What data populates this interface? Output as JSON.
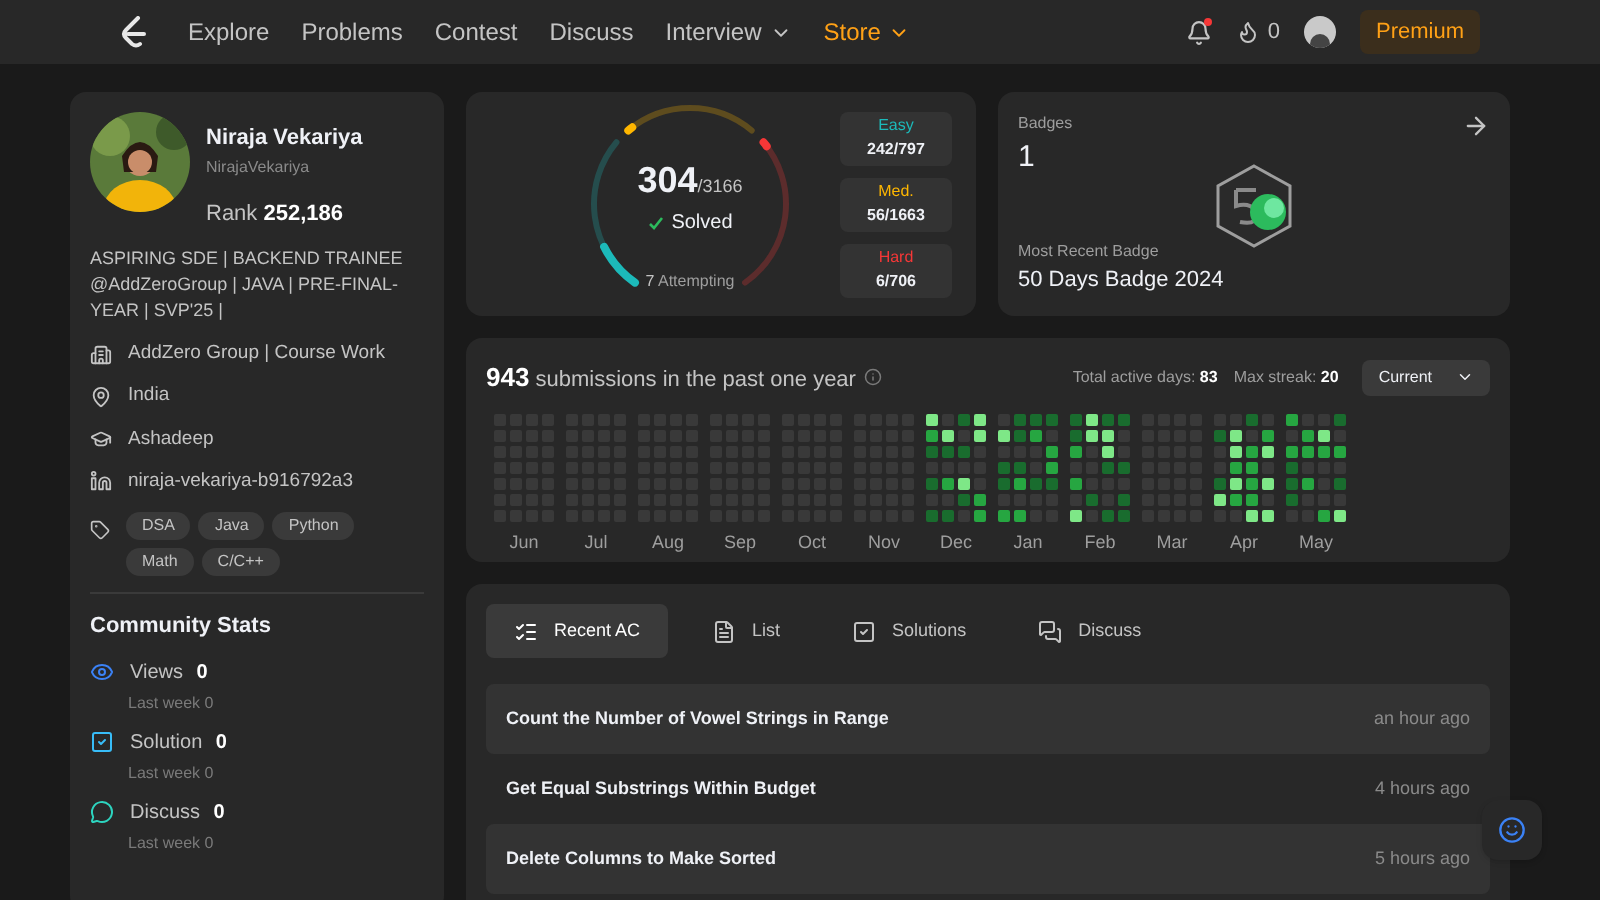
{
  "nav": {
    "links": [
      {
        "label": "Explore",
        "kind": "link"
      },
      {
        "label": "Problems",
        "kind": "link"
      },
      {
        "label": "Contest",
        "kind": "link"
      },
      {
        "label": "Discuss",
        "kind": "link"
      },
      {
        "label": "Interview",
        "kind": "menu"
      },
      {
        "label": "Store",
        "kind": "store"
      }
    ],
    "streak": "0",
    "premium": "Premium"
  },
  "profile": {
    "name": "Niraja Vekariya",
    "username": "NirajaVekariya",
    "rank_label": "Rank",
    "rank": "252,186",
    "bio": "ASPIRING SDE | BACKEND TRAINEE @AddZeroGroup | JAVA | PRE-FINAL-YEAR | SVP'25 |",
    "details": [
      {
        "kind": "work",
        "text": "AddZero Group | Course Work"
      },
      {
        "kind": "location",
        "text": "India"
      },
      {
        "kind": "school",
        "text": "Ashadeep"
      },
      {
        "kind": "linkedin",
        "text": "niraja-vekariya-b916792a3"
      }
    ],
    "skills": [
      "DSA",
      "Java",
      "Python",
      "Math",
      "C/C++"
    ]
  },
  "community": {
    "title": "Community Stats",
    "stats": [
      {
        "kind": "views",
        "label": "Views",
        "value": "0",
        "sub": "Last week",
        "sub_value": "0"
      },
      {
        "kind": "solution",
        "label": "Solution",
        "value": "0",
        "sub": "Last week",
        "sub_value": "0"
      },
      {
        "kind": "discuss",
        "label": "Discuss",
        "value": "0",
        "sub": "Last week",
        "sub_value": "0"
      }
    ]
  },
  "solved": {
    "count": "304",
    "total": "/3166",
    "label": "Solved",
    "attempting": "7",
    "attempting_label": "Attempting",
    "gauge": [
      {
        "color": "#1cbaba",
        "level": 0.3
      },
      {
        "color": "#ffb700",
        "level": 0.034
      },
      {
        "color": "#f63737",
        "level": 0.0085
      }
    ],
    "levels": [
      {
        "label": "Easy",
        "value": "242/797",
        "color": "#1cbaba"
      },
      {
        "label": "Med.",
        "value": "56/1663",
        "color": "#ffb700"
      },
      {
        "label": "Hard",
        "value": "6/706",
        "color": "#f63737"
      }
    ]
  },
  "badges": {
    "title": "Badges",
    "count": "1",
    "recent_label": "Most Recent Badge",
    "recent": "50 Days Badge 2024"
  },
  "calendar": {
    "count": "943",
    "caption": "submissions in the past one year",
    "active_label": "Total active days:",
    "active": "83",
    "streak_label": "Max streak:",
    "streak": "20",
    "range": "Current",
    "months": [
      {
        "label": "Jun",
        "active": false
      },
      {
        "label": "Jul",
        "active": false
      },
      {
        "label": "Aug",
        "active": false
      },
      {
        "label": "Sep",
        "active": false
      },
      {
        "label": "Oct",
        "active": false
      },
      {
        "label": "Nov",
        "active": false
      },
      {
        "label": "Dec",
        "active": true
      },
      {
        "label": "Jan",
        "active": true
      },
      {
        "label": "Feb",
        "active": true
      },
      {
        "label": "Mar",
        "active": false
      },
      {
        "label": "Apr",
        "active": true
      },
      {
        "label": "May",
        "active": true
      }
    ]
  },
  "tabs": [
    {
      "label": "Recent AC",
      "kind": "recent",
      "selected": true
    },
    {
      "label": "List",
      "kind": "list",
      "selected": false
    },
    {
      "label": "Solutions",
      "kind": "solutions",
      "selected": false
    },
    {
      "label": "Discuss",
      "kind": "discuss",
      "selected": false
    }
  ],
  "recent": [
    {
      "title": "Count the Number of Vowel Strings in Range",
      "time": "an hour ago"
    },
    {
      "title": "Get Equal Substrings Within Budget",
      "time": "4 hours ago"
    },
    {
      "title": "Delete Columns to Make Sorted",
      "time": "5 hours ago"
    }
  ]
}
